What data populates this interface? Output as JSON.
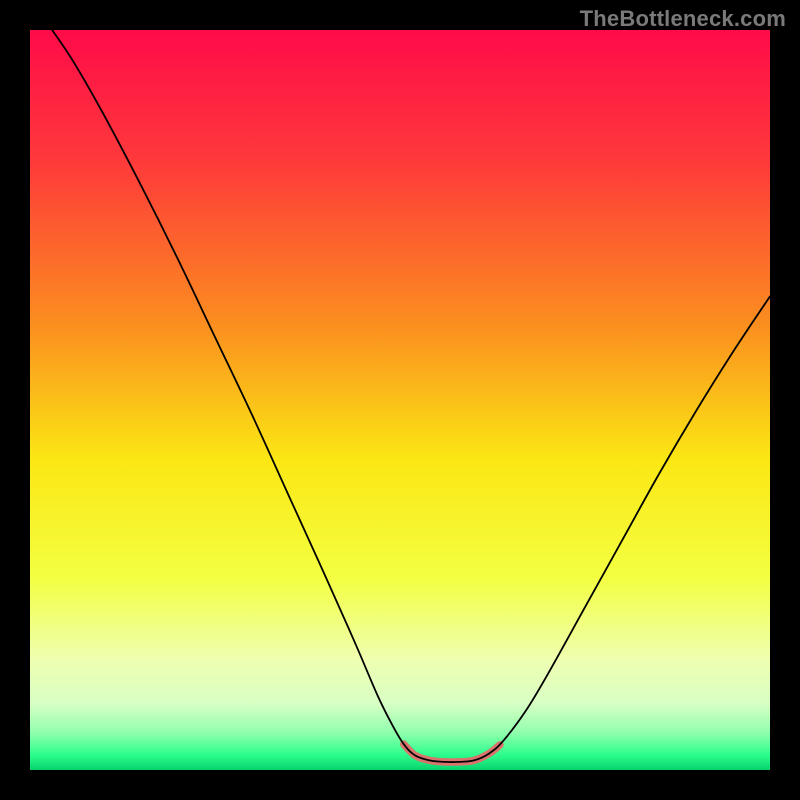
{
  "watermark": "TheBottleneck.com",
  "chart_data": {
    "type": "line",
    "title": "",
    "xlabel": "",
    "ylabel": "",
    "xlim": [
      0,
      100
    ],
    "ylim": [
      0,
      100
    ],
    "gradient_stops": [
      {
        "offset": 0,
        "color": "#ff0b49"
      },
      {
        "offset": 18,
        "color": "#fe3a3a"
      },
      {
        "offset": 40,
        "color": "#fb8f1f"
      },
      {
        "offset": 58,
        "color": "#fbe714"
      },
      {
        "offset": 74,
        "color": "#f3ff41"
      },
      {
        "offset": 85,
        "color": "#efffb0"
      },
      {
        "offset": 91,
        "color": "#d8ffc4"
      },
      {
        "offset": 95,
        "color": "#8fffad"
      },
      {
        "offset": 98,
        "color": "#2bfd8b"
      },
      {
        "offset": 100,
        "color": "#07d36e"
      }
    ],
    "series": [
      {
        "name": "bottleneck-curve",
        "stroke": "#000000",
        "stroke_width": 1.8,
        "points": [
          {
            "x": 3.0,
            "y": 100.0
          },
          {
            "x": 6.0,
            "y": 95.5
          },
          {
            "x": 10.0,
            "y": 88.5
          },
          {
            "x": 15.0,
            "y": 79.0
          },
          {
            "x": 20.0,
            "y": 69.0
          },
          {
            "x": 25.0,
            "y": 58.5
          },
          {
            "x": 30.0,
            "y": 48.0
          },
          {
            "x": 35.0,
            "y": 37.0
          },
          {
            "x": 40.0,
            "y": 26.0
          },
          {
            "x": 44.0,
            "y": 17.0
          },
          {
            "x": 47.0,
            "y": 10.0
          },
          {
            "x": 49.0,
            "y": 6.0
          },
          {
            "x": 50.5,
            "y": 3.5
          },
          {
            "x": 52.0,
            "y": 2.0
          },
          {
            "x": 54.0,
            "y": 1.3
          },
          {
            "x": 56.0,
            "y": 1.1
          },
          {
            "x": 58.0,
            "y": 1.1
          },
          {
            "x": 60.0,
            "y": 1.3
          },
          {
            "x": 62.0,
            "y": 2.2
          },
          {
            "x": 64.0,
            "y": 4.0
          },
          {
            "x": 67.0,
            "y": 8.0
          },
          {
            "x": 70.0,
            "y": 13.0
          },
          {
            "x": 75.0,
            "y": 22.0
          },
          {
            "x": 80.0,
            "y": 31.0
          },
          {
            "x": 85.0,
            "y": 40.0
          },
          {
            "x": 90.0,
            "y": 48.5
          },
          {
            "x": 95.0,
            "y": 56.5
          },
          {
            "x": 100.0,
            "y": 64.0
          }
        ]
      },
      {
        "name": "optimal-band",
        "stroke": "#d9746d",
        "stroke_width": 7.5,
        "linecap": "round",
        "points": [
          {
            "x": 50.5,
            "y": 3.5
          },
          {
            "x": 52.0,
            "y": 2.0
          },
          {
            "x": 54.0,
            "y": 1.3
          },
          {
            "x": 56.0,
            "y": 1.1
          },
          {
            "x": 58.0,
            "y": 1.1
          },
          {
            "x": 60.0,
            "y": 1.3
          },
          {
            "x": 62.0,
            "y": 2.2
          },
          {
            "x": 63.5,
            "y": 3.4
          }
        ]
      }
    ]
  }
}
